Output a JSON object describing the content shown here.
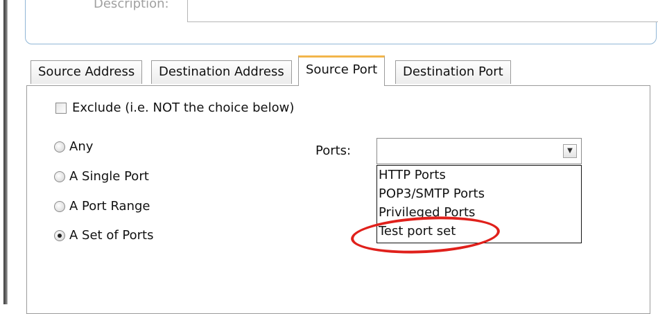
{
  "description": {
    "label": "Description:",
    "value": ""
  },
  "tabs": [
    {
      "label": "Source Address",
      "active": false
    },
    {
      "label": "Destination Address",
      "active": false
    },
    {
      "label": "Source Port",
      "active": true
    },
    {
      "label": "Destination Port",
      "active": false
    }
  ],
  "exclude": {
    "label": "Exclude (i.e. NOT the choice below)",
    "checked": false
  },
  "port_options": [
    {
      "label": "Any",
      "checked": false
    },
    {
      "label": "A Single Port",
      "checked": false
    },
    {
      "label": "A Port Range",
      "checked": false
    },
    {
      "label": "A Set of Ports",
      "checked": true
    }
  ],
  "ports": {
    "label": "Ports:",
    "selected": "",
    "options": [
      "HTTP Ports",
      "POP3/SMTP Ports",
      "Privileged Ports",
      "Test port set"
    ],
    "highlighted": "Test port set"
  },
  "colors": {
    "highlight": "#e0201b",
    "active_tab_accent": "#f2b54a",
    "group_border": "#8fb6d6"
  }
}
